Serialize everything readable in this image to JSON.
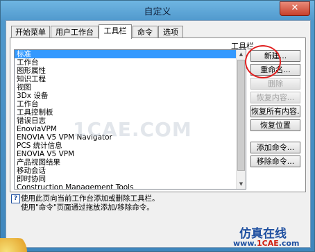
{
  "window": {
    "title": "自定义",
    "close_label": "✕"
  },
  "tabs": [
    {
      "label": "开始菜单"
    },
    {
      "label": "用户工作台"
    },
    {
      "label": "工具栏"
    },
    {
      "label": "命令"
    },
    {
      "label": "选项"
    }
  ],
  "active_tab": "工具栏",
  "list": {
    "header": "工具栏",
    "items": [
      "标准",
      "工作台",
      "图形属性",
      "知识工程",
      "视图",
      "3Dx 设备",
      "工作台",
      "工具控制板",
      "错误日志",
      "EnoviaVPM",
      "ENOVIA V5 VPM Navigator",
      "PCS 统计信息",
      "ENOVIA V5 VPM",
      "产品视图结果",
      "移动会话",
      "即时协同",
      "Construction Management Tools"
    ],
    "selected": "标准"
  },
  "buttons": {
    "new": "新建...",
    "rename": "重命名...",
    "delete": "删除",
    "restore_content": "恢复内容...",
    "restore_all": "恢复所有内容...",
    "restore_position": "恢复位置",
    "add_command": "添加命令...",
    "remove_command": "移除命令..."
  },
  "info": {
    "line1": "使用此页向当前工作台添加或删除工具栏。",
    "line2": "使用\"命令\"页面通过拖放添加/移除命令。"
  },
  "watermarks": {
    "center": "1CAE.COM",
    "brand_cn": "仿真在线",
    "url_prefix": "www.",
    "url_brand": "1CAE",
    "url_suffix": ".com"
  },
  "colors": {
    "title_bar": "#4f98cc",
    "close_button": "#c7402c",
    "selection": "#3399ff",
    "annotation_circle": "#e02020"
  }
}
